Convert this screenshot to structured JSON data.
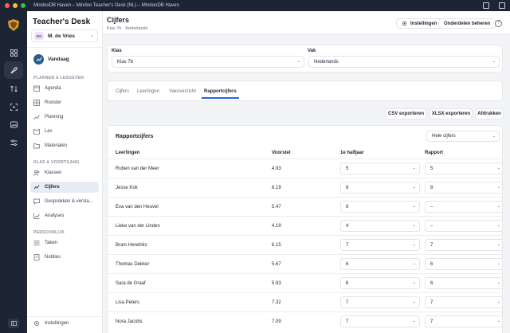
{
  "window": {
    "title": "MindooDB Haven – Mindoo Teacher's Desk (NL) – MindooDB Haven",
    "colors": {
      "close": "#ff5f57",
      "minimize": "#febc2e",
      "maximize": "#28c840"
    }
  },
  "rail": {
    "logo": "shield-logo",
    "items": [
      {
        "icon": "grid-icon",
        "active": false
      },
      {
        "icon": "rocket-icon",
        "active": true
      },
      {
        "icon": "arrows-icon",
        "active": false
      },
      {
        "icon": "scan-icon",
        "active": false
      },
      {
        "icon": "image-icon",
        "active": false
      },
      {
        "icon": "sliders-icon",
        "active": false
      }
    ]
  },
  "sidebar": {
    "brand": "Teacher's Desk",
    "user": {
      "initials": "MD",
      "name": "M. de Vries"
    },
    "today": "Vandaag",
    "sections": {
      "planning": "PLANNEN & LESGEVEN",
      "class": "KLAS & VOORTGANG",
      "personal": "PERSOONLIJK"
    },
    "items": [
      {
        "label": "Agenda",
        "icon": "calendar-icon"
      },
      {
        "label": "Rooster",
        "icon": "timetable-icon"
      },
      {
        "label": "Planning",
        "icon": "planning-icon"
      },
      {
        "label": "Les",
        "icon": "lesson-icon"
      },
      {
        "label": "Materialen",
        "icon": "folder-icon"
      },
      {
        "label": "Klassen",
        "icon": "users-icon"
      },
      {
        "label": "Cijfers",
        "icon": "grades-icon",
        "active": true
      },
      {
        "label": "Gesprekken & versla...",
        "icon": "chat-icon"
      },
      {
        "label": "Analyses",
        "icon": "chart-icon"
      },
      {
        "label": "Taken",
        "icon": "tasks-icon"
      },
      {
        "label": "Notities",
        "icon": "notes-icon"
      }
    ],
    "settings": "Instellingen"
  },
  "header": {
    "title": "Cijfers",
    "breadcrumb": "Klas 7b · Nederlands",
    "settings_label": "Instellingen",
    "share_label": "Onderdelen beheren",
    "help": "?"
  },
  "filters": {
    "class_label": "Klas",
    "class_value": "Klas 7b",
    "subject_label": "Vak",
    "subject_value": "Nederlands"
  },
  "tabs": [
    {
      "label": "Cijfers",
      "active": false
    },
    {
      "label": "Leerlingen",
      "active": false
    },
    {
      "label": "Vakoverzicht",
      "active": false
    },
    {
      "label": "Rapportcijfers",
      "active": true
    }
  ],
  "exports": {
    "csv": "CSV exporteren",
    "xlsx": "XLSX exporteren",
    "print": "Afdrukken"
  },
  "table": {
    "title": "Rapportcijfers",
    "scope": "Hele cijfers",
    "columns": [
      "Leerlingen",
      "Voorstel",
      "1e halfjaar",
      "Rapport"
    ],
    "rows": [
      {
        "name": "Ruben van der Meer",
        "voorstel": "4.93",
        "half": "5",
        "rapport": "5"
      },
      {
        "name": "Jesse Kok",
        "voorstel": "8.19",
        "half": "8",
        "rapport": "8"
      },
      {
        "name": "Eva van den Heuvel",
        "voorstel": "5.47",
        "half": "6",
        "rapport": "–"
      },
      {
        "name": "Lieke van der Linden",
        "voorstel": "4.19",
        "half": "4",
        "rapport": "–"
      },
      {
        "name": "Bram Hendriks",
        "voorstel": "6.15",
        "half": "7",
        "rapport": "7"
      },
      {
        "name": "Thomas Dekker",
        "voorstel": "5.67",
        "half": "6",
        "rapport": "6"
      },
      {
        "name": "Sara de Graaf",
        "voorstel": "5.93",
        "half": "6",
        "rapport": "6"
      },
      {
        "name": "Lisa Peters",
        "voorstel": "7.32",
        "half": "7",
        "rapport": "7"
      },
      {
        "name": "Nora Jacobs",
        "voorstel": "7.09",
        "half": "7",
        "rapport": "7"
      }
    ]
  }
}
